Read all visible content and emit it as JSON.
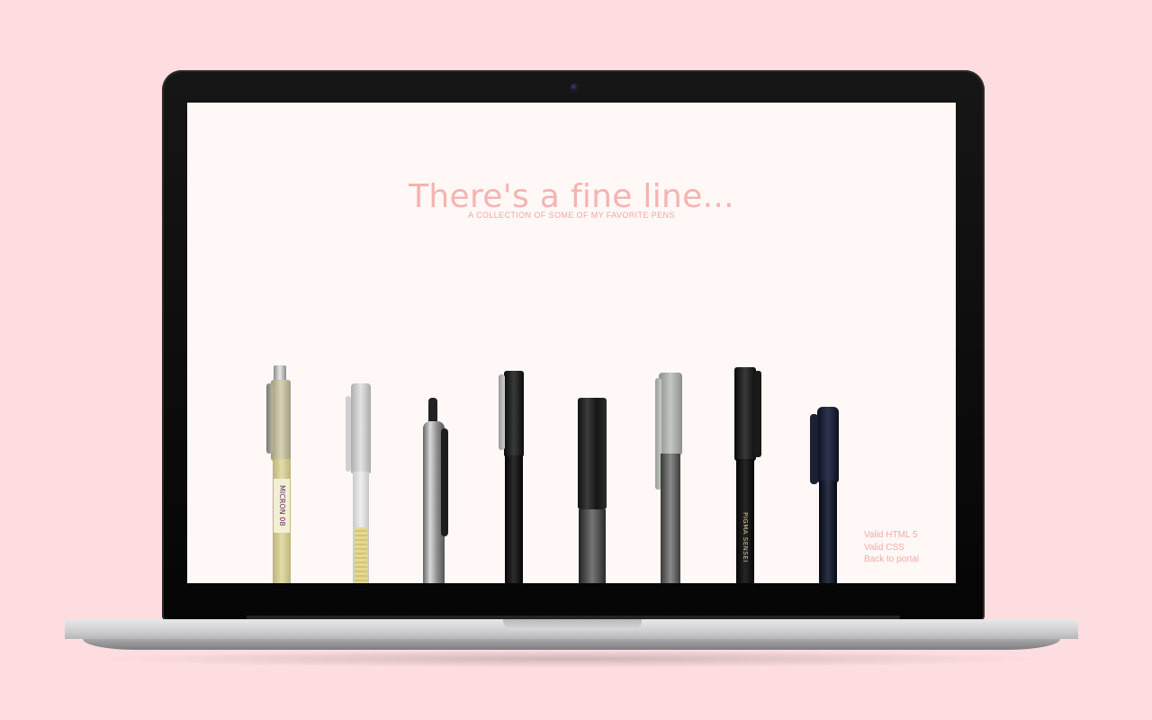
{
  "site": {
    "title": "There's a fine line...",
    "subtitle": "A COLLECTION OF SOME OF MY FAVORITE PENS"
  },
  "footer": {
    "links": [
      "Valid HTML 5",
      "Valid CSS",
      "Back to portal"
    ]
  },
  "pens": [
    {
      "name": "sakura-micron-pen",
      "label": "MICRON 08"
    },
    {
      "name": "muji-gel-pen",
      "label": ""
    },
    {
      "name": "silver-retractable-pen",
      "label": ""
    },
    {
      "name": "black-clip-pen",
      "label": ""
    },
    {
      "name": "hexagonal-black-pen",
      "label": ""
    },
    {
      "name": "grey-cap-pen",
      "label": ""
    },
    {
      "name": "pigma-sensei-pen",
      "label": "PIGMA SENSEI"
    },
    {
      "name": "navy-brush-pen",
      "label": ""
    }
  ],
  "colors": {
    "background": "#fddde0",
    "screen": "#fff8f7",
    "accent": "#f6b4b0"
  }
}
